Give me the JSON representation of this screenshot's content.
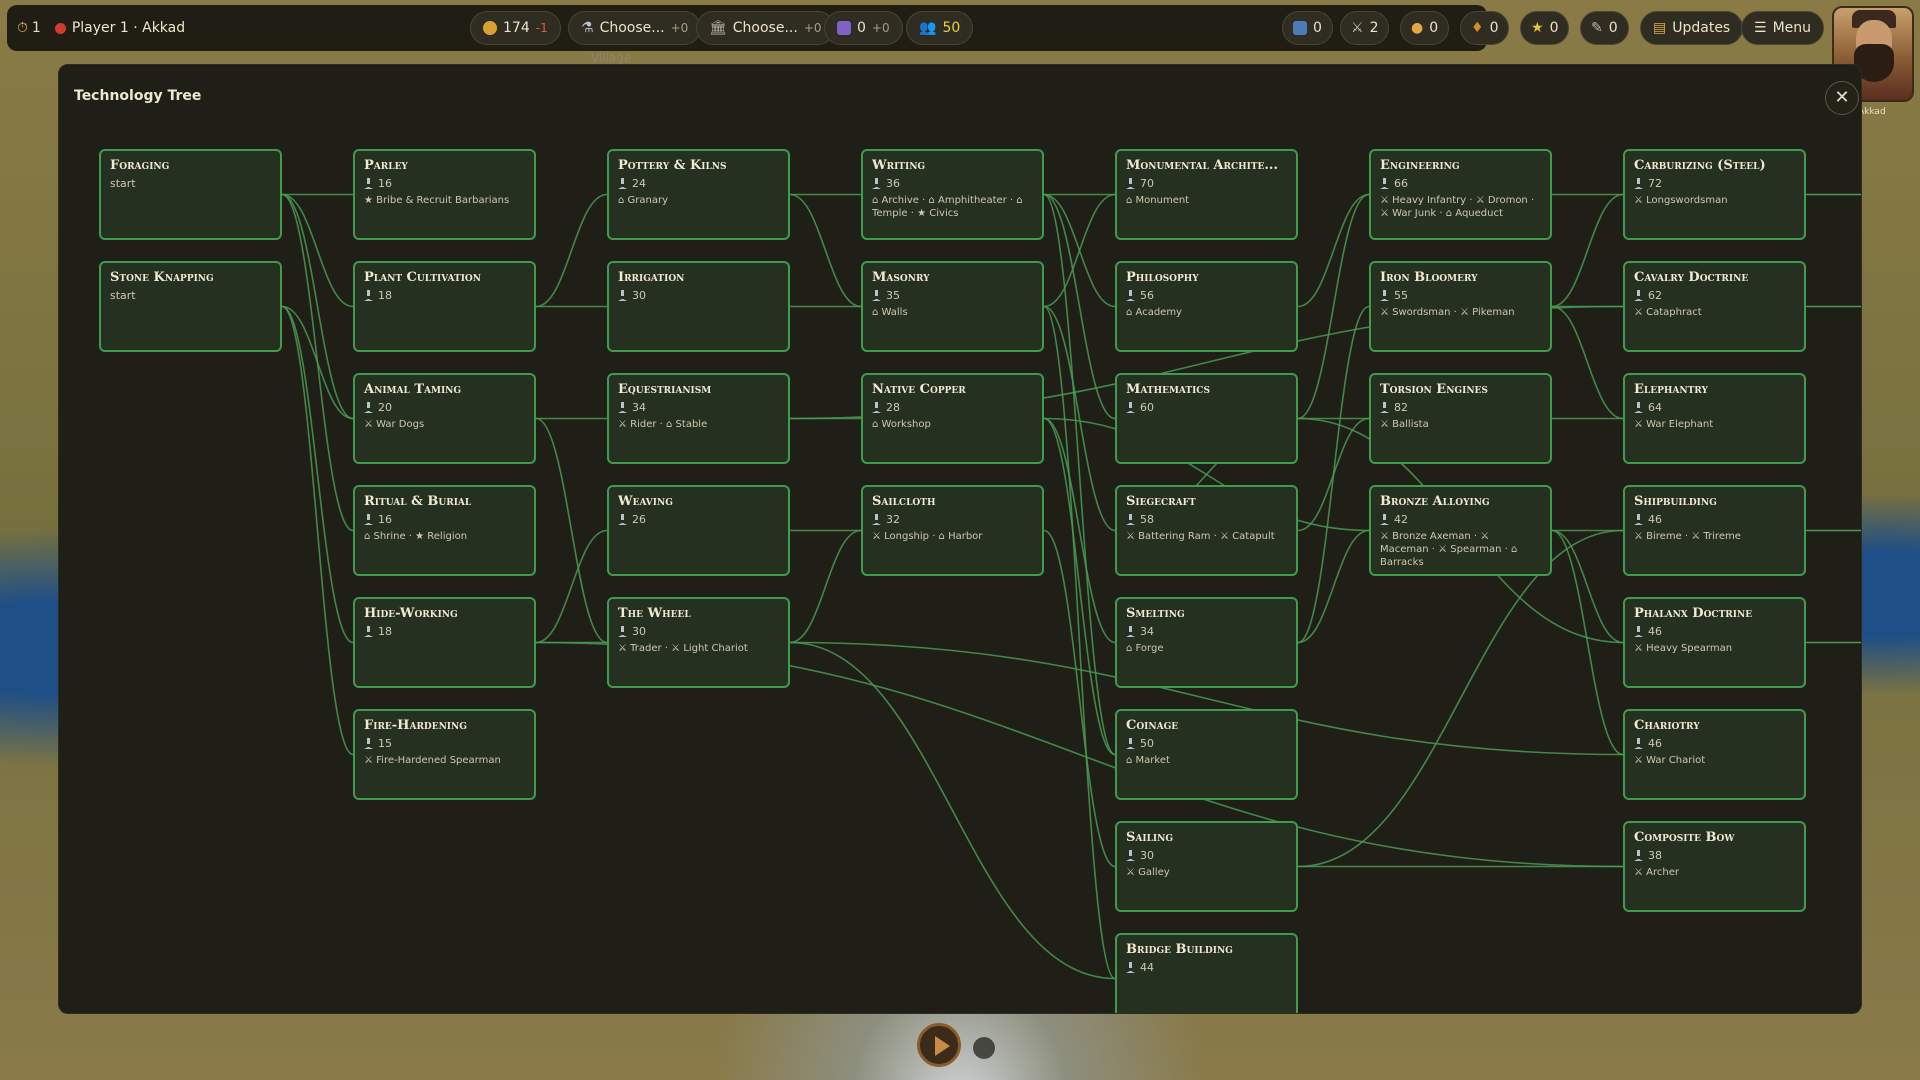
{
  "topbar": {
    "turn": "1",
    "player": "Player 1 · Akkad",
    "gold": "174",
    "gold_delta": "-1",
    "research_label": "Choose...",
    "research_delta": "+0",
    "civic_label": "Choose...",
    "civic_delta": "+0",
    "faith": "0",
    "faith_delta": "+0",
    "happiness": "50",
    "stat1": "0",
    "stat2": "2",
    "stat3": "0",
    "stat4": "0",
    "stat5": "0",
    "stat6": "0",
    "updates_label": "Updates",
    "menu_label": "Menu",
    "village_label": "Village",
    "leader_name": "Akkad"
  },
  "panel": {
    "title": "Technology Tree",
    "close_label": "✕"
  },
  "techs": {
    "foraging": {
      "name": "Foraging",
      "cost": "start",
      "unlocks": ""
    },
    "stone_knapping": {
      "name": "Stone Knapping",
      "cost": "start",
      "unlocks": ""
    },
    "parley": {
      "name": "Parley",
      "cost": "16",
      "unlocks": "★ Bribe & Recruit Barbarians"
    },
    "plant_cultivation": {
      "name": "Plant Cultivation",
      "cost": "18",
      "unlocks": ""
    },
    "animal_taming": {
      "name": "Animal Taming",
      "cost": "20",
      "unlocks": "⚔ War Dogs"
    },
    "ritual_burial": {
      "name": "Ritual & Burial",
      "cost": "16",
      "unlocks": "⌂ Shrine · ★ Religion"
    },
    "hide_working": {
      "name": "Hide-Working",
      "cost": "18",
      "unlocks": ""
    },
    "fire_hardening": {
      "name": "Fire-Hardening",
      "cost": "15",
      "unlocks": "⚔ Fire-Hardened Spearman"
    },
    "pottery_kilns": {
      "name": "Pottery & Kilns",
      "cost": "24",
      "unlocks": "⌂ Granary"
    },
    "irrigation": {
      "name": "Irrigation",
      "cost": "30",
      "unlocks": ""
    },
    "equestrianism": {
      "name": "Equestrianism",
      "cost": "34",
      "unlocks": "⚔ Rider · ⌂ Stable"
    },
    "weaving": {
      "name": "Weaving",
      "cost": "26",
      "unlocks": ""
    },
    "the_wheel": {
      "name": "The Wheel",
      "cost": "30",
      "unlocks": "⚔ Trader · ⚔ Light Chariot"
    },
    "writing": {
      "name": "Writing",
      "cost": "36",
      "unlocks": "⌂ Archive · ⌂ Amphitheater · ⌂ Temple · ★ Civics"
    },
    "masonry": {
      "name": "Masonry",
      "cost": "35",
      "unlocks": "⌂ Walls"
    },
    "native_copper": {
      "name": "Native Copper",
      "cost": "28",
      "unlocks": "⌂ Workshop"
    },
    "sailcloth": {
      "name": "Sailcloth",
      "cost": "32",
      "unlocks": "⚔ Longship · ⌂ Harbor"
    },
    "monumental_architecture": {
      "name": "Monumental Archite...",
      "cost": "70",
      "unlocks": "⌂ Monument"
    },
    "philosophy": {
      "name": "Philosophy",
      "cost": "56",
      "unlocks": "⌂ Academy"
    },
    "mathematics": {
      "name": "Mathematics",
      "cost": "60",
      "unlocks": ""
    },
    "siegecraft": {
      "name": "Siegecraft",
      "cost": "58",
      "unlocks": "⚔ Battering Ram · ⚔ Catapult"
    },
    "smelting": {
      "name": "Smelting",
      "cost": "34",
      "unlocks": "⌂ Forge"
    },
    "coinage": {
      "name": "Coinage",
      "cost": "50",
      "unlocks": "⌂ Market"
    },
    "sailing": {
      "name": "Sailing",
      "cost": "30",
      "unlocks": "⚔ Galley"
    },
    "bridge_building": {
      "name": "Bridge Building",
      "cost": "44",
      "unlocks": ""
    },
    "engineering": {
      "name": "Engineering",
      "cost": "66",
      "unlocks": "⚔ Heavy Infantry · ⚔ Dromon · ⚔ War Junk · ⌂ Aqueduct"
    },
    "iron_bloomery": {
      "name": "Iron Bloomery",
      "cost": "55",
      "unlocks": "⚔ Swordsman · ⚔ Pikeman"
    },
    "torsion_engines": {
      "name": "Torsion Engines",
      "cost": "82",
      "unlocks": "⚔ Ballista"
    },
    "bronze_alloying": {
      "name": "Bronze Alloying",
      "cost": "42",
      "unlocks": "⚔ Bronze Axeman · ⚔ Maceman · ⚔ Spearman · ⌂ Barracks"
    },
    "carburizing": {
      "name": "Carburizing (Steel)",
      "cost": "72",
      "unlocks": "⚔ Longswordsman"
    },
    "cavalry_doctrine": {
      "name": "Cavalry Doctrine",
      "cost": "62",
      "unlocks": "⚔ Cataphract"
    },
    "elephantry": {
      "name": "Elephantry",
      "cost": "64",
      "unlocks": "⚔ War Elephant"
    },
    "shipbuilding": {
      "name": "Shipbuilding",
      "cost": "46",
      "unlocks": "⚔ Bireme · ⚔ Trireme"
    },
    "phalanx_doctrine": {
      "name": "Phalanx Doctrine",
      "cost": "46",
      "unlocks": "⚔ Heavy Spearman"
    },
    "chariotry": {
      "name": "Chariotry",
      "cost": "46",
      "unlocks": "⚔ War Chariot"
    },
    "composite_bow": {
      "name": "Composite Bow",
      "cost": "38",
      "unlocks": "⚔ Archer"
    }
  },
  "colors": {
    "node_border": "#3f9c4c",
    "edge": "#4a9a52",
    "panel_bg": "#1f1f18"
  }
}
